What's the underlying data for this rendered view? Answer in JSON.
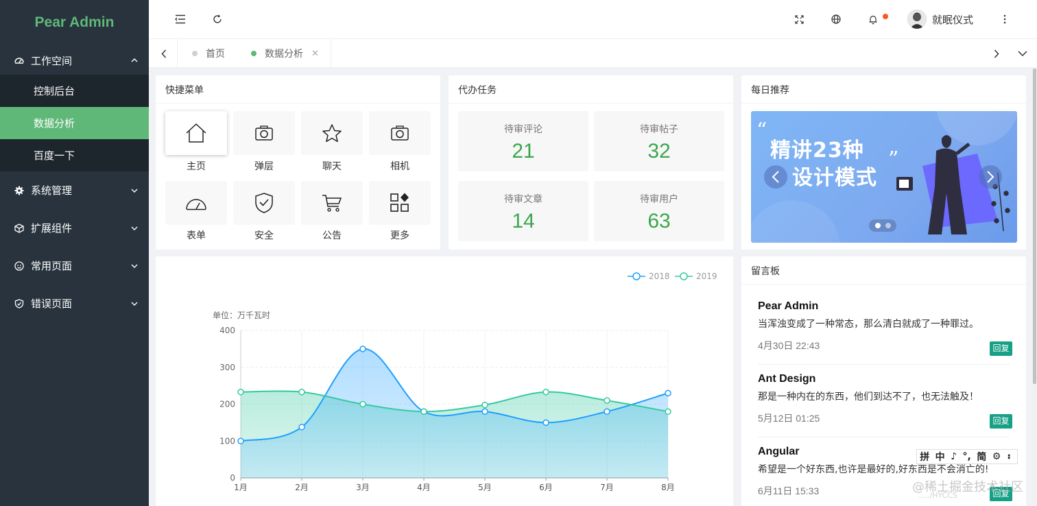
{
  "app": {
    "logo": "Pear Admin"
  },
  "sidebar": {
    "groups": [
      {
        "label": "工作空间",
        "icon": "dashboard-icon",
        "expanded": true,
        "items": [
          {
            "label": "控制后台",
            "active": false
          },
          {
            "label": "数据分析",
            "active": true
          },
          {
            "label": "百度一下",
            "active": false
          }
        ]
      },
      {
        "label": "系统管理",
        "icon": "gear-icon",
        "expanded": false
      },
      {
        "label": "扩展组件",
        "icon": "cube-icon",
        "expanded": false
      },
      {
        "label": "常用页面",
        "icon": "smile-icon",
        "expanded": false
      },
      {
        "label": "错误页面",
        "icon": "shield-check-icon",
        "expanded": false
      }
    ]
  },
  "header": {
    "user_name": "就眠仪式",
    "icons": [
      "menu-fold-icon",
      "refresh-icon",
      "fullscreen-icon",
      "globe-icon",
      "bell-icon",
      "more-vertical-icon"
    ],
    "notification_dot_color": "#ff5722"
  },
  "tabs": {
    "items": [
      {
        "label": "首页",
        "active": false
      },
      {
        "label": "数据分析",
        "active": true
      }
    ],
    "active_color": "#5fb878"
  },
  "quick_menu": {
    "title": "快捷菜单",
    "items": [
      {
        "label": "主页",
        "icon": "home-icon"
      },
      {
        "label": "弹层",
        "icon": "camera-icon"
      },
      {
        "label": "聊天",
        "icon": "star-icon"
      },
      {
        "label": "相机",
        "icon": "camera-icon"
      },
      {
        "label": "表单",
        "icon": "gauge-icon"
      },
      {
        "label": "安全",
        "icon": "shield-check-icon"
      },
      {
        "label": "公告",
        "icon": "cart-icon"
      },
      {
        "label": "更多",
        "icon": "apps-icon"
      }
    ]
  },
  "tasks": {
    "title": "代办任务",
    "items": [
      {
        "label": "待审评论",
        "count": "21"
      },
      {
        "label": "待审帖子",
        "count": "32"
      },
      {
        "label": "待审文章",
        "count": "14"
      },
      {
        "label": "待审用户",
        "count": "63"
      }
    ],
    "number_color": "#3aa64b"
  },
  "daily": {
    "title": "每日推荐",
    "banner_line1": "精讲23种",
    "banner_line2": "设计模式",
    "carousel_active_index": 0
  },
  "chart_data": {
    "type": "area",
    "unit_label": "单位：万千瓦时",
    "categories": [
      "1月",
      "2月",
      "3月",
      "4月",
      "5月",
      "6月",
      "7月",
      "8月"
    ],
    "ylim": [
      0,
      400
    ],
    "yticks": [
      0,
      100,
      200,
      300,
      400
    ],
    "smooth": true,
    "grid": true,
    "legend_placement": "top-right",
    "series": [
      {
        "name": "2018",
        "color": "#1e9fff",
        "values": [
          100,
          138,
          350,
          180,
          180,
          150,
          180,
          230
        ]
      },
      {
        "name": "2019",
        "color": "#36c9a0",
        "values": [
          233,
          233,
          200,
          180,
          198,
          233,
          210,
          180
        ]
      }
    ]
  },
  "messages": {
    "title": "留言板",
    "reply_label": "回复",
    "items": [
      {
        "name": "Pear Admin",
        "text": "当浑浊变成了一种常态，那么清白就成了一种罪过。",
        "time": "4月30日 22:43"
      },
      {
        "name": "Ant Design",
        "text": "那是一种内在的东西，他们到达不了，也无法触及！",
        "time": "5月12日 01:25"
      },
      {
        "name": "Angular",
        "text": "希望是一个好东西,也许是最好的,好东西是不会消亡的!",
        "time": "6月11日 15:33"
      }
    ]
  },
  "overlay": {
    "ime_chars": [
      "拼",
      "中",
      "♪",
      "°,",
      "简",
      "⚙",
      "⠆"
    ],
    "watermark": "@稀土掘金技术社区",
    "watermark_sub": "...../HYCCS"
  }
}
